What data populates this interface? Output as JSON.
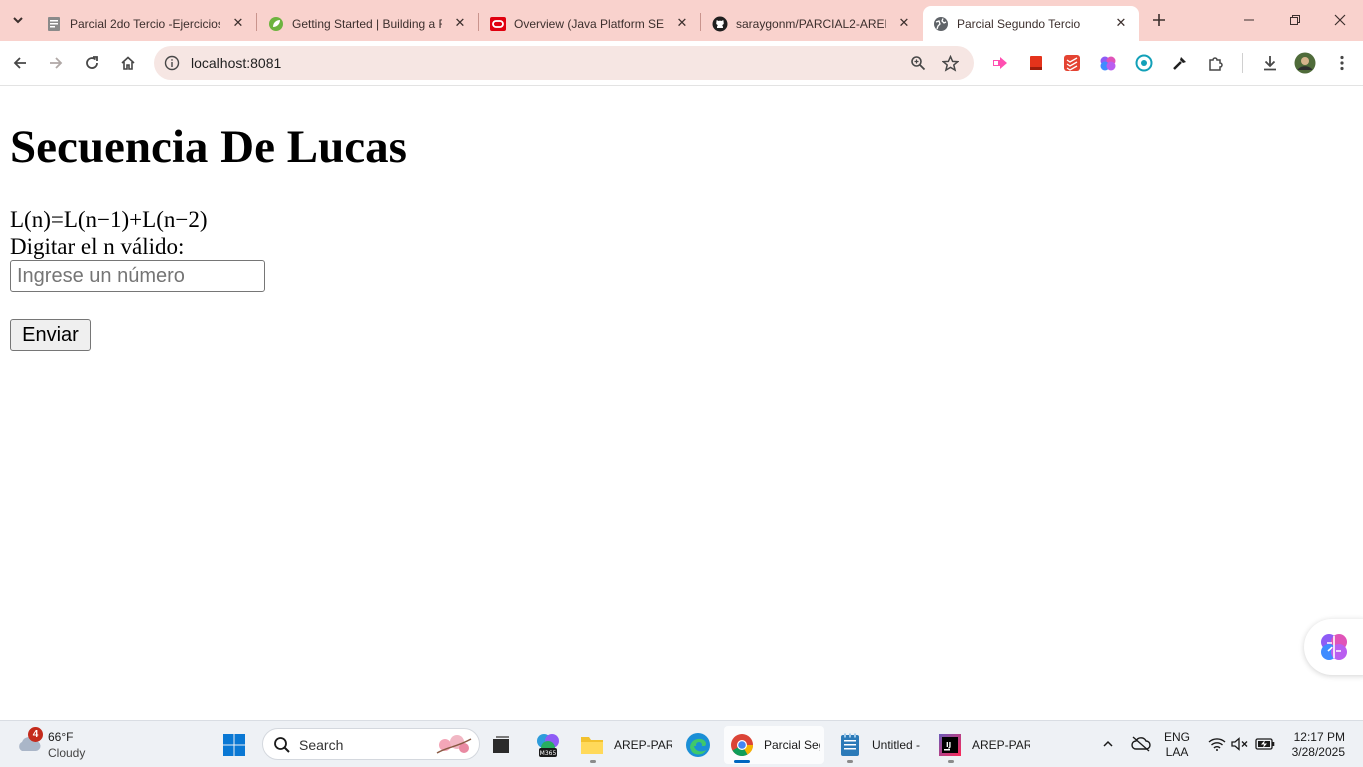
{
  "browser": {
    "tabs": [
      {
        "title": "Parcial 2do Tercio -Ejercicios",
        "favicon": "document-icon",
        "active": false
      },
      {
        "title": "Getting Started | Building a R",
        "favicon": "spring-leaf-icon",
        "active": false
      },
      {
        "title": "Overview (Java Platform SE 8",
        "favicon": "oracle-icon",
        "active": false
      },
      {
        "title": "saraygonm/PARCIAL2-AREP",
        "favicon": "github-icon",
        "active": false
      },
      {
        "title": "Parcial Segundo Tercio",
        "favicon": "globe-icon",
        "active": true
      }
    ],
    "address": "localhost:8081",
    "colors": {
      "frame": "#f9d2cd",
      "omnibox": "#f6e6e3"
    }
  },
  "page": {
    "heading": "Secuencia De Lucas",
    "formula": "L(n)=L(n−1)+L(n−2)",
    "prompt_label": "Digitar el n válido:",
    "input_placeholder": "Ingrese un número",
    "input_value": "",
    "submit_label": "Enviar"
  },
  "taskbar": {
    "weather": {
      "temp": "66°F",
      "condition": "Cloudy",
      "badge": "4"
    },
    "search_placeholder": "Search",
    "apps": [
      {
        "label": "AREP-PAR",
        "icon": "folder-icon"
      },
      {
        "label": "Parcial Seg",
        "icon": "chrome-icon"
      },
      {
        "label": "Untitled -",
        "icon": "notepad-icon"
      },
      {
        "label": "AREP-PAR",
        "icon": "intellij-icon"
      }
    ],
    "language": {
      "line1": "ENG",
      "line2": "LAA"
    },
    "clock": {
      "time": "12:17 PM",
      "date": "3/28/2025"
    }
  }
}
